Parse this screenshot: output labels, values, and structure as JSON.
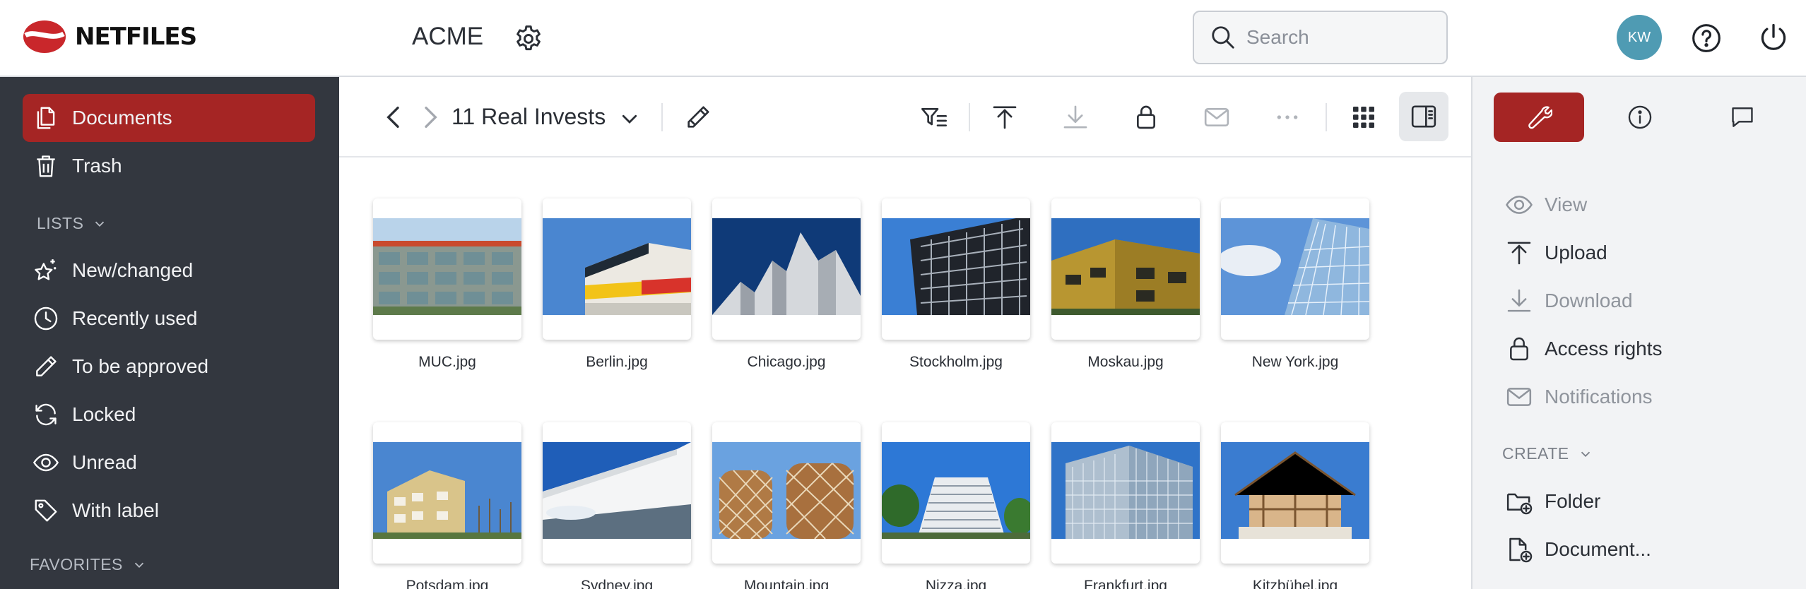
{
  "app": {
    "brand": "NETFILES",
    "company": "ACME",
    "search_placeholder": "Search",
    "user_initials": "KW"
  },
  "sidebar": {
    "main": [
      {
        "label": "Documents",
        "icon": "documents-icon",
        "active": true
      },
      {
        "label": "Trash",
        "icon": "trash-icon"
      }
    ],
    "lists_header": "LISTS",
    "lists": [
      {
        "label": "New/changed",
        "icon": "sparkle-star-icon"
      },
      {
        "label": "Recently used",
        "icon": "clock-icon"
      },
      {
        "label": "To be approved",
        "icon": "pencil-icon"
      },
      {
        "label": "Locked",
        "icon": "refresh-icon"
      },
      {
        "label": "Unread",
        "icon": "eye-icon"
      },
      {
        "label": "With label",
        "icon": "tag-icon"
      }
    ],
    "favorites_header": "FAVORITES"
  },
  "toolbar": {
    "folder_title": "11 Real Invests",
    "icons": [
      "back-arrow-icon",
      "forward-arrow-icon",
      "chevron-down-icon",
      "edit-pencil-icon",
      "filter-icon",
      "upload-icon",
      "download-icon",
      "lock-icon",
      "mail-icon",
      "more-icon",
      "grid-view-icon",
      "sidebar-panel-icon"
    ]
  },
  "files": [
    {
      "name": "MUC.jpg"
    },
    {
      "name": "Berlin.jpg"
    },
    {
      "name": "Chicago.jpg"
    },
    {
      "name": "Stockholm.jpg"
    },
    {
      "name": "Moskau.jpg"
    },
    {
      "name": "New York.jpg"
    },
    {
      "name": "Potsdam.jpg"
    },
    {
      "name": "Sydney.jpg"
    },
    {
      "name": "Mountain.jpg"
    },
    {
      "name": "Nizza.jpg"
    },
    {
      "name": "Frankfurt.jpg"
    },
    {
      "name": "Kitzbühel.jpg"
    }
  ],
  "right_panel": {
    "tabs": [
      "wrench-icon",
      "info-icon",
      "comment-icon"
    ],
    "actions": [
      {
        "label": "View",
        "icon": "eye-icon",
        "enabled": false
      },
      {
        "label": "Upload",
        "icon": "upload-icon",
        "enabled": true
      },
      {
        "label": "Download",
        "icon": "download-icon",
        "enabled": false
      },
      {
        "label": "Access rights",
        "icon": "lock-icon",
        "enabled": true
      },
      {
        "label": "Notifications",
        "icon": "mail-icon",
        "enabled": false
      }
    ],
    "create_header": "CREATE",
    "create": [
      {
        "label": "Folder",
        "icon": "folder-add-icon"
      },
      {
        "label": "Document...",
        "icon": "document-add-icon"
      }
    ]
  },
  "colors": {
    "accent": "#a52524",
    "sidebar_bg": "#33373f",
    "avatar_bg": "#4f9bb3",
    "panel_bg": "#f2f3f5"
  }
}
